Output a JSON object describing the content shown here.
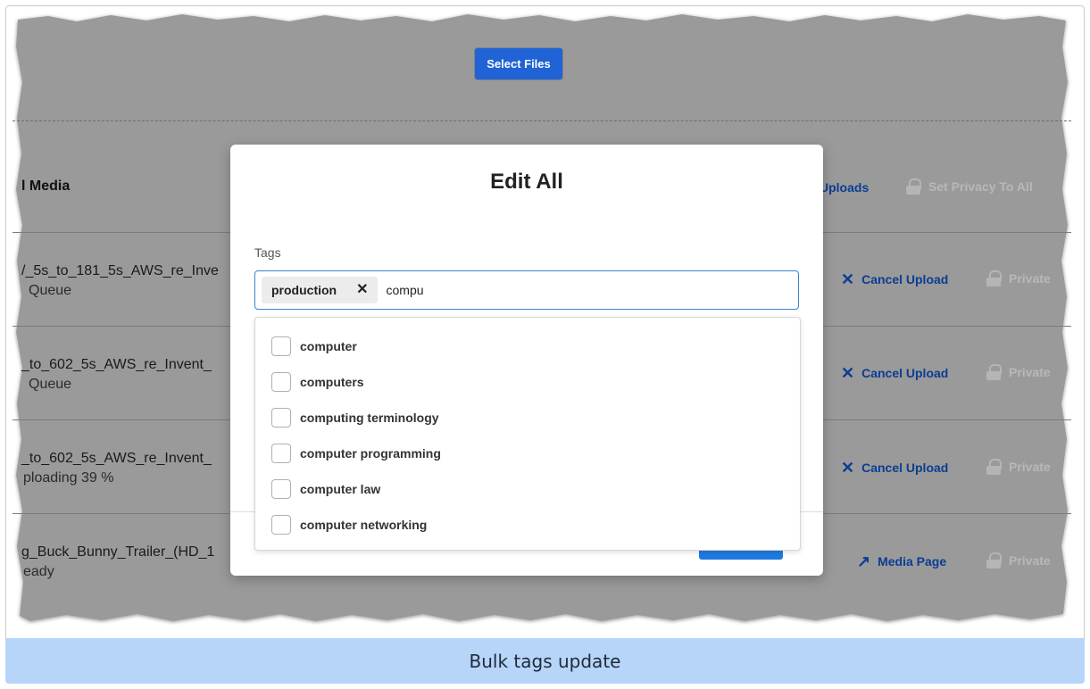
{
  "upload": {
    "select_files": "Select Files"
  },
  "list": {
    "header": "l Media",
    "uploads_link": "Uploads",
    "set_privacy_all": "Set Privacy To All",
    "rows": [
      {
        "name": "/_5s_to_181_5s_AWS_re_Inve",
        "status": "Queue",
        "action": "Cancel Upload",
        "privacy": "Private"
      },
      {
        "name": "_to_602_5s_AWS_re_Invent_",
        "status": "Queue",
        "action": "Cancel Upload",
        "privacy": "Private"
      },
      {
        "name": "_to_602_5s_AWS_re_Invent_",
        "status": "ploading 39 %",
        "action": "Cancel Upload",
        "privacy": "Private"
      },
      {
        "name": "g_Buck_Bunny_Trailer_(HD_1",
        "status": "eady",
        "action": "Media Page",
        "privacy": "Private"
      }
    ]
  },
  "modal": {
    "title": "Edit All",
    "tags_label": "Tags",
    "chip_label": "production",
    "typed_value": "compu",
    "options": [
      "computer",
      "computers",
      "computing terminology",
      "computer programming",
      "computer law",
      "computer networking"
    ]
  },
  "caption": "Bulk tags update",
  "colors": {
    "accent": "#1f63d6",
    "overlay": "#9a9a9a",
    "caption_bg": "#b7d5f9"
  }
}
